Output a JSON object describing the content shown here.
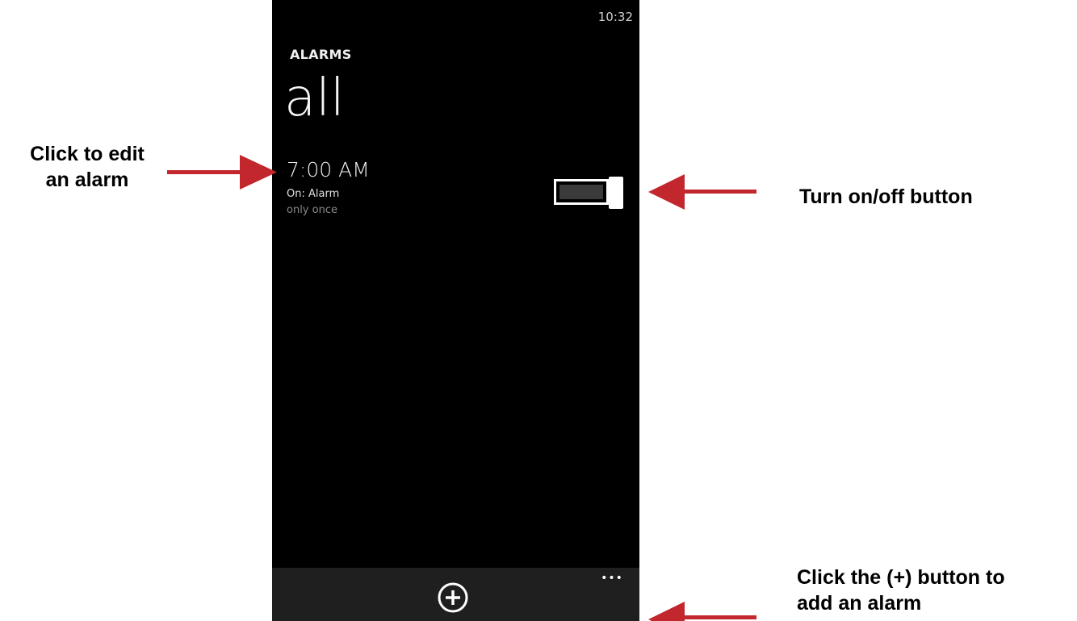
{
  "status_bar": {
    "time": "10:32"
  },
  "header": {
    "app_title": "ALARMS",
    "page_title": "all"
  },
  "alarms": [
    {
      "time": "7:00 AM",
      "status": "On: Alarm",
      "repeat": "only once",
      "enabled": true
    }
  ],
  "app_bar": {
    "add_icon": "plus-circle-icon",
    "more_label": "•••"
  },
  "annotations": {
    "edit_alarm": [
      "Click to edit",
      "an alarm"
    ],
    "toggle": "Turn on/off button",
    "add_alarm": [
      "Click the (+) button to",
      "add an alarm"
    ]
  },
  "colors": {
    "arrow": "#c1272d",
    "phone_background": "#000000",
    "app_bar_background": "#1f1f1f"
  }
}
